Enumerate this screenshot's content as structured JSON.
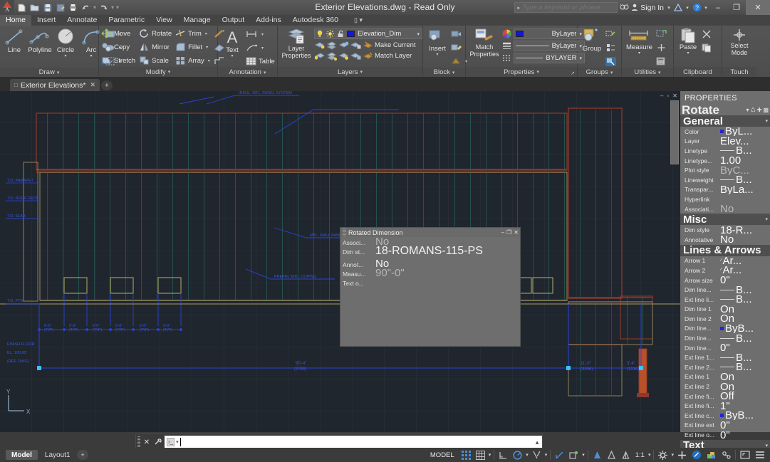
{
  "titlebar": {
    "app_menu_letter": "A",
    "document_title": "Exterior Elevations.dwg - Read Only",
    "quick_access": [
      {
        "name": "new",
        "glyph": "⬜"
      },
      {
        "name": "open",
        "glyph": "🗁"
      },
      {
        "name": "save",
        "glyph": "💾"
      },
      {
        "name": "save-as",
        "glyph": "🖫"
      },
      {
        "name": "plot",
        "glyph": "🖨"
      },
      {
        "name": "undo",
        "glyph": "↶"
      },
      {
        "name": "undo-dropdown",
        "glyph": "▾"
      },
      {
        "name": "redo",
        "glyph": "↷"
      },
      {
        "name": "redo-dropdown",
        "glyph": "▾"
      },
      {
        "name": "customize",
        "glyph": "▾"
      }
    ],
    "search_placeholder": "Type a keyword or phrase",
    "sign_in_label": "Sign In",
    "window_buttons": {
      "minimize": "–",
      "restore": "❐",
      "close": "✕"
    }
  },
  "ribbon_tabs": [
    {
      "label": "Home",
      "active": true
    },
    {
      "label": "Insert",
      "active": false
    },
    {
      "label": "Annotate",
      "active": false
    },
    {
      "label": "Parametric",
      "active": false
    },
    {
      "label": "View",
      "active": false
    },
    {
      "label": "Manage",
      "active": false
    },
    {
      "label": "Output",
      "active": false
    },
    {
      "label": "Add-ins",
      "active": false
    },
    {
      "label": "Autodesk 360",
      "active": false
    }
  ],
  "ribbon": {
    "draw": {
      "title": "Draw",
      "big": [
        {
          "label": "Line",
          "dropdown": false
        },
        {
          "label": "Polyline",
          "dropdown": false
        },
        {
          "label": "Circle",
          "dropdown": true
        },
        {
          "label": "Arc",
          "dropdown": true
        }
      ],
      "small_icons": [
        "rectangle",
        "ellipse",
        "hatch"
      ]
    },
    "modify": {
      "title": "Modify",
      "items": [
        {
          "label": "Move",
          "dropdown": false
        },
        {
          "label": "Rotate",
          "dropdown": false
        },
        {
          "label": "Trim",
          "dropdown": true
        },
        {
          "label": "Copy",
          "dropdown": false
        },
        {
          "label": "Mirror",
          "dropdown": false
        },
        {
          "label": "Fillet",
          "dropdown": true
        },
        {
          "label": "Stretch",
          "dropdown": false
        },
        {
          "label": "Scale",
          "dropdown": false
        },
        {
          "label": "Array",
          "dropdown": true
        }
      ],
      "extra_icons": [
        "explode",
        "erase",
        "offset"
      ]
    },
    "annotation": {
      "title": "Annotation",
      "big": [
        {
          "label": "Text",
          "dropdown": true
        }
      ],
      "small": [
        {
          "label": "",
          "icon": "dimension",
          "dropdown": true
        },
        {
          "label": "",
          "icon": "leader",
          "dropdown": true
        },
        {
          "label": "Table",
          "icon": "table",
          "dropdown": false
        }
      ]
    },
    "layers": {
      "title": "Layers",
      "big": [
        {
          "label": "Layer\nProperties",
          "dropdown": false
        }
      ],
      "layer_combo": {
        "value": "Elevation_Dim",
        "color": "#1414dd"
      },
      "toggle_icons": [
        "lightbulb-on",
        "sun-freeze",
        "lock-open"
      ],
      "actions": [
        {
          "label": "Make Current"
        },
        {
          "label": "Match Layer"
        }
      ]
    },
    "block": {
      "title": "Block",
      "big": [
        {
          "label": "Insert",
          "dropdown": true
        }
      ]
    },
    "properties": {
      "title": "Properties",
      "big": [
        {
          "label": "Match\nProperties",
          "dropdown": false
        }
      ],
      "combos": [
        {
          "name": "color",
          "value": "ByLayer",
          "swatch": "#1414dd"
        },
        {
          "name": "lineweight",
          "value": "ByLayer",
          "swatch": null
        },
        {
          "name": "linetype",
          "value": "BYLAYER",
          "swatch": null
        }
      ]
    },
    "groups": {
      "title": "Groups",
      "big": [
        {
          "label": "Group",
          "dropdown": true
        }
      ]
    },
    "utilities": {
      "title": "Utilities",
      "big": [
        {
          "label": "Measure",
          "dropdown": true
        }
      ]
    },
    "clipboard": {
      "title": "Clipboard",
      "big": [
        {
          "label": "Paste",
          "dropdown": true
        }
      ]
    },
    "touch": {
      "title": "Touch",
      "big": [
        {
          "label": "Select\nMode",
          "dropdown": false
        }
      ]
    }
  },
  "file_tabs": [
    {
      "label": "Exterior Elevations*",
      "active": true
    },
    {
      "label": "+",
      "active": false
    }
  ],
  "drawing": {
    "viewport_buttons": {
      "minimize": "–",
      "restore": "▫",
      "close": "✕"
    },
    "ucs_labels": {
      "y": "Y",
      "x": "X"
    },
    "background": "#20262e",
    "colors": {
      "wall_outline": "#8c6b42",
      "rib_lines": "#2d8f7a",
      "roof_red": "#8e3a2a",
      "dimension_blue": "#2a43d8",
      "grid": "#2a323c",
      "column_orange": "#b8502a"
    }
  },
  "rotated_dimension_palette": {
    "title": "Rotated Dimension",
    "header_buttons": {
      "minimize": "–",
      "auto_hide": "❐",
      "close": "✕"
    },
    "rows": [
      {
        "key": "Associ...",
        "value": "No",
        "dim": true
      },
      {
        "key": "Dim st...",
        "value": "18-ROMANS-115-PS",
        "dim": false
      },
      {
        "key": "Annot...",
        "value": "No",
        "dim": false
      },
      {
        "key": "Measu...",
        "value": "90\"-0\"",
        "dim": true
      },
      {
        "key": "Text o...",
        "value": "",
        "dim": false
      }
    ]
  },
  "properties_palette": {
    "title": "PROPERTIES",
    "selection": "Rotate",
    "selection_buttons": [
      "refresh-icon",
      "quick-select-icon",
      "pick-icon"
    ],
    "sections": [
      {
        "name": "General",
        "rows": [
          {
            "key": "Color",
            "value": "ByL...",
            "marker": "dot"
          },
          {
            "key": "Layer",
            "value": "Elev...",
            "marker": null
          },
          {
            "key": "Linetype",
            "value": "B...",
            "marker": "line"
          },
          {
            "key": "Linetype...",
            "value": "1.00",
            "marker": null
          },
          {
            "key": "Plot style",
            "value": "ByC...",
            "marker": null,
            "grey": true
          },
          {
            "key": "Lineweight",
            "value": "B...",
            "marker": "line"
          },
          {
            "key": "Transpar...",
            "value": "ByLa...",
            "marker": null
          },
          {
            "key": "Hyperlink",
            "value": "",
            "marker": null
          },
          {
            "key": "Associati...",
            "value": "No",
            "marker": null,
            "grey": true
          }
        ]
      },
      {
        "name": "Misc",
        "rows": [
          {
            "key": "Dim style",
            "value": "18-R...",
            "marker": null
          },
          {
            "key": "Annotative",
            "value": "No",
            "marker": null
          }
        ]
      },
      {
        "name": "Lines & Arrows",
        "rows": [
          {
            "key": "Arrow 1",
            "value": "Ar...",
            "marker": "slash"
          },
          {
            "key": "Arrow 2",
            "value": "Ar...",
            "marker": "slash"
          },
          {
            "key": "Arrow size",
            "value": "0\"",
            "marker": null
          },
          {
            "key": "Dim line...",
            "value": "B...",
            "marker": "line"
          },
          {
            "key": "Ext line li...",
            "value": "B...",
            "marker": "line"
          },
          {
            "key": "Dim line 1",
            "value": "On",
            "marker": null
          },
          {
            "key": "Dim line 2",
            "value": "On",
            "marker": null
          },
          {
            "key": "Dim line...",
            "value": "ByB...",
            "marker": "dot"
          },
          {
            "key": "Dim line...",
            "value": "B...",
            "marker": "line"
          },
          {
            "key": "Dim line...",
            "value": "0\"",
            "marker": null
          },
          {
            "key": "Ext line 1...",
            "value": "B...",
            "marker": "line"
          },
          {
            "key": "Ext line 2...",
            "value": "B...",
            "marker": "line"
          },
          {
            "key": "Ext line 1",
            "value": "On",
            "marker": null
          },
          {
            "key": "Ext line 2",
            "value": "On",
            "marker": null
          },
          {
            "key": "Ext line fi...",
            "value": "Off",
            "marker": null
          },
          {
            "key": "Ext line fi...",
            "value": "1\"",
            "marker": null
          },
          {
            "key": "Ext line c...",
            "value": "ByB...",
            "marker": "dot"
          },
          {
            "key": "Ext line ext",
            "value": "0\"",
            "marker": null
          },
          {
            "key": "Ext line o...",
            "value": "0\"",
            "marker": null
          }
        ]
      },
      {
        "name": "Text",
        "rows": []
      }
    ]
  },
  "command_line": {
    "prompt_icon": "⌫",
    "value": "",
    "close_icon": "✕",
    "settings_icon": "🔧"
  },
  "status_bar": {
    "layout_tabs": [
      {
        "label": "Model",
        "active": true
      },
      {
        "label": "Layout1",
        "active": false
      },
      {
        "label": "+",
        "active": false
      }
    ],
    "space_label": "MODEL",
    "toggles": [
      {
        "name": "grid-display",
        "active": true
      },
      {
        "name": "snap-mode",
        "active": false
      },
      {
        "name": "snap-dropdown",
        "active": false
      },
      {
        "name": "ortho-mode",
        "active": false
      },
      {
        "name": "polar-tracking",
        "active": true
      },
      {
        "name": "polar-dropdown",
        "active": false
      },
      {
        "name": "object-snap",
        "active": false
      },
      {
        "name": "osnap-dropdown",
        "active": false
      },
      {
        "name": "object-snap-tracking",
        "active": false
      },
      {
        "name": "ucs-icon",
        "active": true
      },
      {
        "name": "ucs-dropdown",
        "active": false
      },
      {
        "name": "annotation-visibility",
        "active": true
      },
      {
        "name": "autoscale",
        "active": false
      },
      {
        "name": "annotation-scale-lock",
        "active": false
      }
    ],
    "annotation_scale": "1:1",
    "right_icons": [
      {
        "name": "workspace-switch-gear"
      },
      {
        "name": "workspace-dropdown"
      },
      {
        "name": "hardware-accel-plus"
      },
      {
        "name": "isolate-objects"
      },
      {
        "name": "graphics-performance"
      },
      {
        "name": "clean-screen-toggle"
      },
      {
        "name": "fullscreen"
      },
      {
        "name": "customization-menu"
      }
    ]
  }
}
